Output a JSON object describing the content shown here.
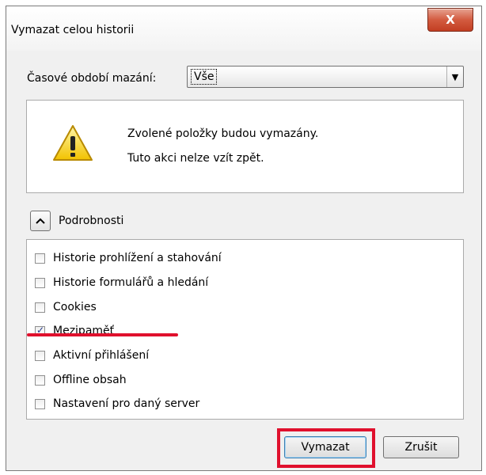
{
  "window": {
    "title": "Vymazat celou historii",
    "close_label": "X"
  },
  "range": {
    "label": "Časové období mazání:",
    "selected": "Vše"
  },
  "warning": {
    "line1": "Zvolené položky budou vymazány.",
    "line2": "Tuto akci nelze vzít zpět."
  },
  "details": {
    "label": "Podrobnosti"
  },
  "items": [
    {
      "label": "Historie prohlížení a stahování",
      "checked": false
    },
    {
      "label": "Historie formulářů a hledání",
      "checked": false
    },
    {
      "label": "Cookies",
      "checked": false
    },
    {
      "label": "Mezipaměť",
      "checked": true
    },
    {
      "label": "Aktivní přihlášení",
      "checked": false
    },
    {
      "label": "Offline obsah",
      "checked": false
    },
    {
      "label": "Nastavení pro daný server",
      "checked": false
    }
  ],
  "buttons": {
    "confirm": "Vymazat",
    "cancel": "Zrušit"
  },
  "annotations": {
    "highlight_color": "#e0102d"
  }
}
